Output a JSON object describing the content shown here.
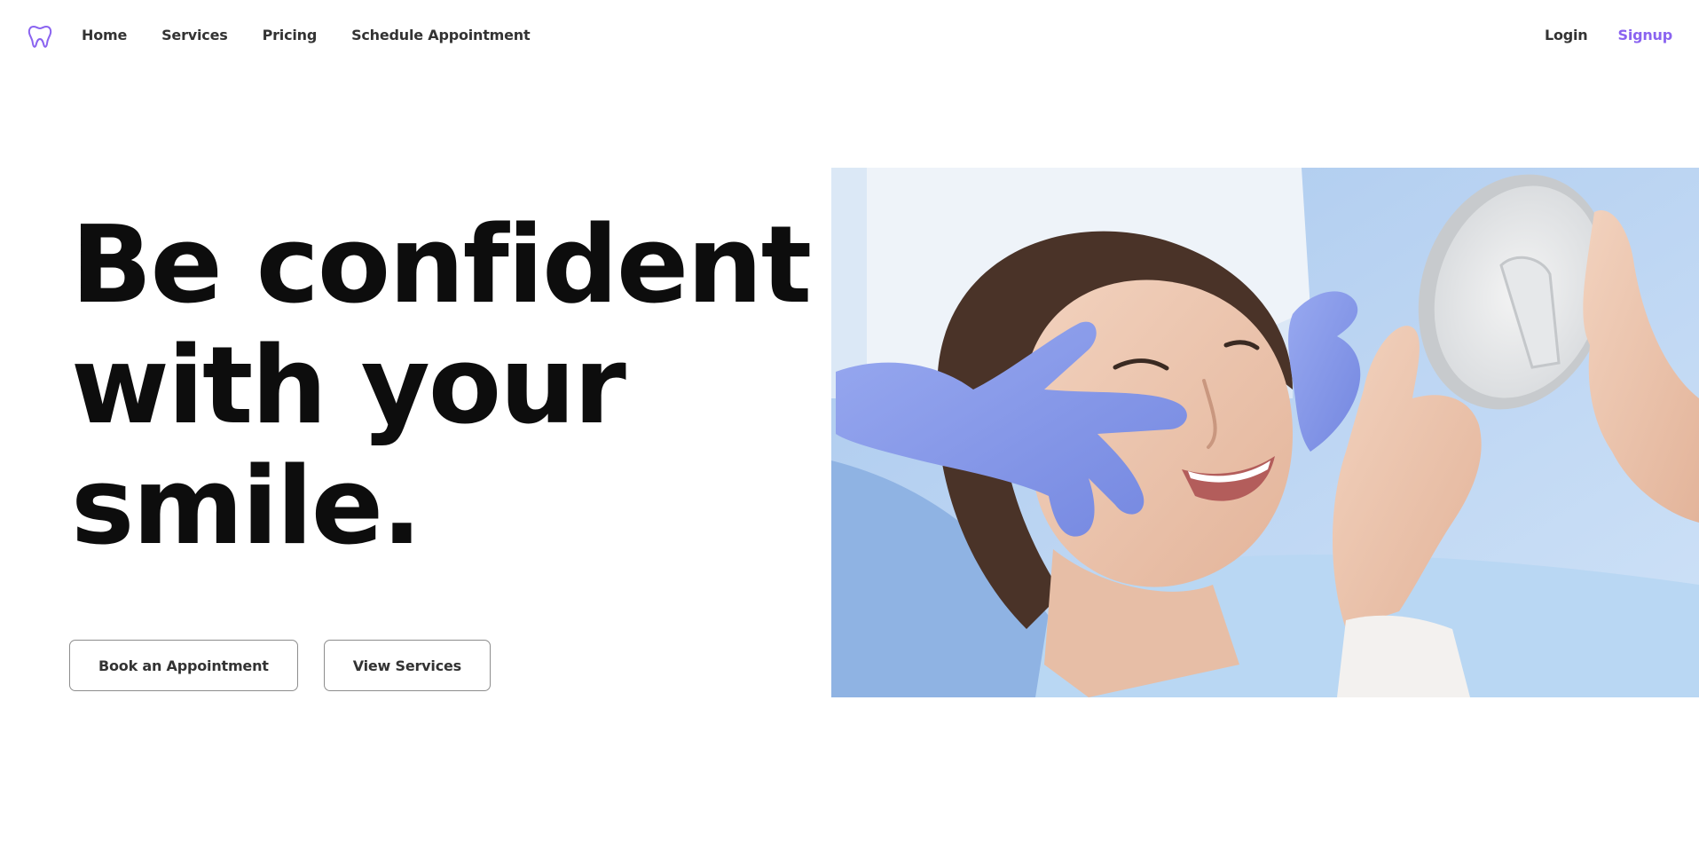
{
  "nav": {
    "logo_icon": "tooth-icon",
    "links": [
      {
        "label": "Home"
      },
      {
        "label": "Services"
      },
      {
        "label": "Pricing"
      },
      {
        "label": "Schedule Appointment"
      }
    ],
    "login_label": "Login",
    "signup_label": "Signup"
  },
  "hero": {
    "headline_lines": [
      "Be confident",
      "with your",
      "smile."
    ],
    "primary_button": "Book an Appointment",
    "secondary_button": "View Services",
    "image_alt": "Woman smiling at a mirror during a dental visit"
  },
  "colors": {
    "accent": "#8a63f0",
    "text": "#0d0d0d",
    "nav_text": "#333333",
    "button_border": "#8d8d8d"
  }
}
